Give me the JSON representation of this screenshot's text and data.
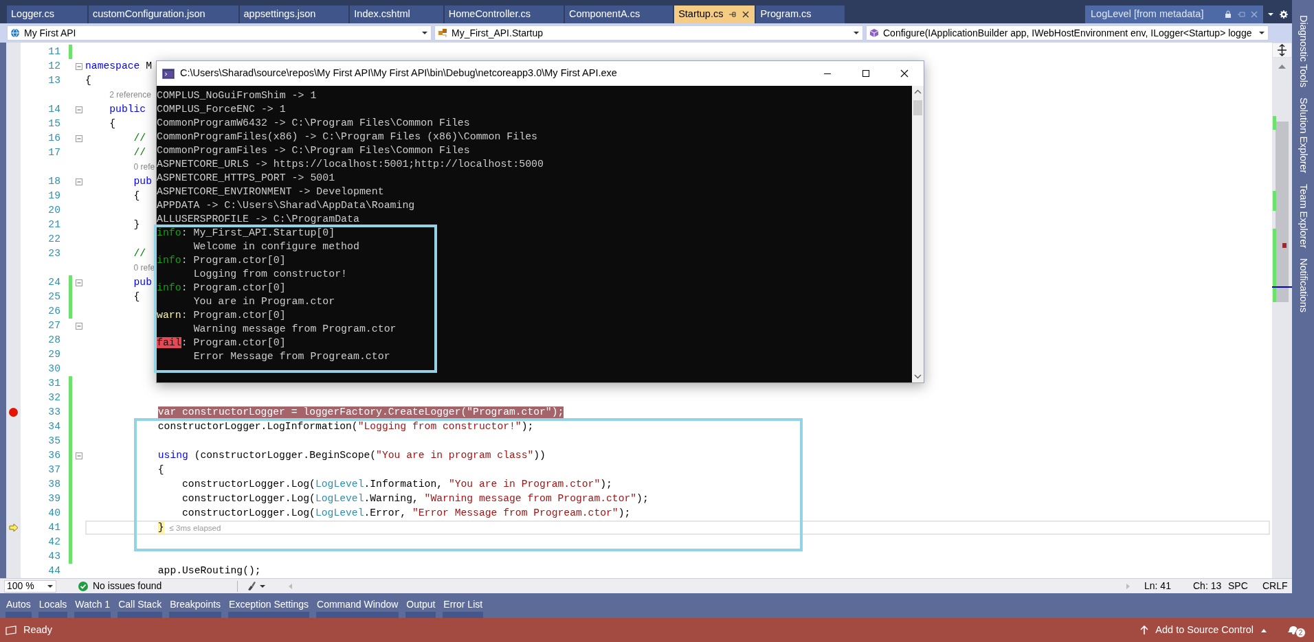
{
  "document_tabs": [
    {
      "label": "Logger.cs",
      "selected": false
    },
    {
      "label": "customConfiguration.json",
      "selected": false
    },
    {
      "label": "appsettings.json",
      "selected": false
    },
    {
      "label": "Index.cshtml",
      "selected": false
    },
    {
      "label": "HomeController.cs",
      "selected": false
    },
    {
      "label": "ComponentA.cs",
      "selected": false
    },
    {
      "label": "Startup.cs",
      "selected": true
    },
    {
      "label": "Program.cs",
      "selected": false
    }
  ],
  "preview_tab": {
    "label": "LogLevel [from metadata]"
  },
  "navigation_bar": {
    "project": "My First API",
    "type": "My_First_API.Startup",
    "member": "Configure(IApplicationBuilder app, IWebHostEnvironment env, ILogger<Startup> logge"
  },
  "editor": {
    "lines": [
      {
        "kind": "code",
        "number": "11",
        "changed": true,
        "foldable": false,
        "breakpoint": false,
        "current": false
      },
      {
        "kind": "code",
        "number": "12",
        "changed": false,
        "foldable": true,
        "breakpoint": false,
        "current": false,
        "tokens": [
          {
            "text": "namespace",
            "kind": "keyword"
          },
          {
            "text": " M",
            "kind": "plain"
          }
        ]
      },
      {
        "kind": "code",
        "number": "13",
        "changed": false,
        "foldable": false,
        "breakpoint": false,
        "current": false,
        "tokens": [
          {
            "text": "{",
            "kind": "plain"
          }
        ]
      },
      {
        "kind": "codelens",
        "text": "2 reference"
      },
      {
        "kind": "code",
        "number": "14",
        "changed": false,
        "foldable": true,
        "breakpoint": false,
        "current": false,
        "tokens": [
          {
            "text": "    public",
            "kind": "keyword"
          }
        ]
      },
      {
        "kind": "code",
        "number": "15",
        "changed": false,
        "foldable": false,
        "breakpoint": false,
        "current": false,
        "tokens": [
          {
            "text": "    {",
            "kind": "plain"
          }
        ]
      },
      {
        "kind": "code",
        "number": "16",
        "changed": false,
        "foldable": true,
        "breakpoint": false,
        "current": false,
        "tokens": [
          {
            "text": "        //",
            "kind": "comment"
          }
        ]
      },
      {
        "kind": "code",
        "number": "17",
        "changed": false,
        "foldable": false,
        "breakpoint": false,
        "current": false,
        "tokens": [
          {
            "text": "        //",
            "kind": "comment"
          }
        ]
      },
      {
        "kind": "codelens",
        "text": "0 refe"
      },
      {
        "kind": "code",
        "number": "18",
        "changed": false,
        "foldable": true,
        "breakpoint": false,
        "current": false,
        "tokens": [
          {
            "text": "        pub",
            "kind": "keyword"
          }
        ]
      },
      {
        "kind": "code",
        "number": "19",
        "changed": false,
        "foldable": false,
        "breakpoint": false,
        "current": false,
        "tokens": [
          {
            "text": "        {",
            "kind": "plain"
          }
        ]
      },
      {
        "kind": "code",
        "number": "20",
        "changed": false,
        "foldable": false,
        "breakpoint": false,
        "current": false
      },
      {
        "kind": "code",
        "number": "21",
        "changed": false,
        "foldable": false,
        "breakpoint": false,
        "current": false,
        "tokens": [
          {
            "text": "        }",
            "kind": "plain"
          }
        ]
      },
      {
        "kind": "code",
        "number": "22",
        "changed": false,
        "foldable": false,
        "breakpoint": false,
        "current": false
      },
      {
        "kind": "code",
        "number": "23",
        "changed": false,
        "foldable": false,
        "breakpoint": false,
        "current": false,
        "tokens": [
          {
            "text": "        //",
            "kind": "comment"
          }
        ]
      },
      {
        "kind": "codelens",
        "text": "0 refe"
      },
      {
        "kind": "code",
        "number": "24",
        "changed": true,
        "foldable": true,
        "breakpoint": false,
        "current": false,
        "tokens": [
          {
            "text": "        pub",
            "kind": "keyword"
          }
        ]
      },
      {
        "kind": "code",
        "number": "25",
        "changed": true,
        "foldable": false,
        "breakpoint": false,
        "current": false,
        "tokens": [
          {
            "text": "        {",
            "kind": "plain"
          }
        ]
      },
      {
        "kind": "code",
        "number": "26",
        "changed": true,
        "foldable": false,
        "breakpoint": false,
        "current": false
      },
      {
        "kind": "code",
        "number": "27",
        "changed": false,
        "foldable": true,
        "breakpoint": false,
        "current": false
      },
      {
        "kind": "code",
        "number": "28",
        "changed": false,
        "foldable": false,
        "breakpoint": false,
        "current": false
      },
      {
        "kind": "code",
        "number": "29",
        "changed": false,
        "foldable": false,
        "breakpoint": false,
        "current": false
      },
      {
        "kind": "code",
        "number": "30",
        "changed": false,
        "foldable": false,
        "breakpoint": false,
        "current": false
      },
      {
        "kind": "code",
        "number": "31",
        "changed": true,
        "foldable": false,
        "breakpoint": false,
        "current": false
      },
      {
        "kind": "code",
        "number": "32",
        "changed": true,
        "foldable": false,
        "breakpoint": false,
        "current": false
      },
      {
        "kind": "code",
        "number": "33",
        "changed": true,
        "foldable": false,
        "breakpoint": true,
        "current": false,
        "tokens": [
          {
            "text": "            var constructorLogger = loggerFactory.CreateLogger(\"Program.ctor\");",
            "kind": "plain"
          }
        ]
      },
      {
        "kind": "code",
        "number": "34",
        "changed": true,
        "foldable": false,
        "breakpoint": false,
        "current": false,
        "tokens": [
          {
            "text": "            constructorLogger.LogInformation(",
            "kind": "plain"
          },
          {
            "text": "\"Logging from constructor!\"",
            "kind": "string"
          },
          {
            "text": ");",
            "kind": "plain"
          }
        ]
      },
      {
        "kind": "code",
        "number": "35",
        "changed": true,
        "foldable": false,
        "breakpoint": false,
        "current": false
      },
      {
        "kind": "code",
        "number": "36",
        "changed": true,
        "foldable": true,
        "breakpoint": false,
        "current": false,
        "tokens": [
          {
            "text": "            using",
            "kind": "keyword"
          },
          {
            "text": " (constructorLogger.BeginScope(",
            "kind": "plain"
          },
          {
            "text": "\"You are in program class\"",
            "kind": "string"
          },
          {
            "text": "))",
            "kind": "plain"
          }
        ]
      },
      {
        "kind": "code",
        "number": "37",
        "changed": true,
        "foldable": false,
        "breakpoint": false,
        "current": false,
        "tokens": [
          {
            "text": "            {",
            "kind": "plain"
          }
        ]
      },
      {
        "kind": "code",
        "number": "38",
        "changed": true,
        "foldable": false,
        "breakpoint": false,
        "current": false,
        "tokens": [
          {
            "text": "                constructorLogger.Log(",
            "kind": "plain"
          },
          {
            "text": "LogLevel",
            "kind": "type"
          },
          {
            "text": ".Information, ",
            "kind": "plain"
          },
          {
            "text": "\"You are in Program.ctor\"",
            "kind": "string"
          },
          {
            "text": ");",
            "kind": "plain"
          }
        ]
      },
      {
        "kind": "code",
        "number": "39",
        "changed": true,
        "foldable": false,
        "breakpoint": false,
        "current": false,
        "tokens": [
          {
            "text": "                constructorLogger.Log(",
            "kind": "plain"
          },
          {
            "text": "LogLevel",
            "kind": "type"
          },
          {
            "text": ".Warning, ",
            "kind": "plain"
          },
          {
            "text": "\"Warning message from Program.ctor\"",
            "kind": "string"
          },
          {
            "text": ");",
            "kind": "plain"
          }
        ]
      },
      {
        "kind": "code",
        "number": "40",
        "changed": true,
        "foldable": false,
        "breakpoint": false,
        "current": false,
        "tokens": [
          {
            "text": "                constructorLogger.Log(",
            "kind": "plain"
          },
          {
            "text": "LogLevel",
            "kind": "type"
          },
          {
            "text": ".Error, ",
            "kind": "plain"
          },
          {
            "text": "\"Error Message from Progream.ctor\"",
            "kind": "string"
          },
          {
            "text": ");",
            "kind": "plain"
          }
        ]
      },
      {
        "kind": "code",
        "number": "41",
        "changed": true,
        "foldable": false,
        "breakpoint": false,
        "current": true,
        "hint": "≤ 3ms elapsed",
        "tokens": [
          {
            "text": "            }",
            "kind": "plain"
          }
        ]
      },
      {
        "kind": "code",
        "number": "42",
        "changed": true,
        "foldable": false,
        "breakpoint": false,
        "current": false
      },
      {
        "kind": "code",
        "number": "43",
        "changed": true,
        "foldable": false,
        "breakpoint": false,
        "current": false
      },
      {
        "kind": "code",
        "number": "44",
        "changed": false,
        "foldable": false,
        "breakpoint": false,
        "current": false,
        "tokens": [
          {
            "text": "            app.UseRouting();",
            "kind": "plain"
          }
        ]
      }
    ]
  },
  "console_window": {
    "title": "C:\\Users\\Sharad\\source\\repos\\My First API\\My First API\\bin\\Debug\\netcoreapp3.0\\My First API.exe",
    "lines": [
      {
        "kind": "plain",
        "text": "COMPLUS_NoGuiFromShim -> 1"
      },
      {
        "kind": "plain",
        "text": "COMPLUS_ForceENC -> 1"
      },
      {
        "kind": "plain",
        "text": "CommonProgramW6432 -> C:\\Program Files\\Common Files"
      },
      {
        "kind": "plain",
        "text": "CommonProgramFiles(x86) -> C:\\Program Files (x86)\\Common Files"
      },
      {
        "kind": "plain",
        "text": "CommonProgramFiles -> C:\\Program Files\\Common Files"
      },
      {
        "kind": "plain",
        "text": "ASPNETCORE_URLS -> https://localhost:5001;http://localhost:5000"
      },
      {
        "kind": "plain",
        "text": "ASPNETCORE_HTTPS_PORT -> 5001"
      },
      {
        "kind": "plain",
        "text": "ASPNETCORE_ENVIRONMENT -> Development"
      },
      {
        "kind": "plain",
        "text": "APPDATA -> C:\\Users\\Sharad\\AppData\\Roaming"
      },
      {
        "kind": "plain",
        "text": "ALLUSERSPROFILE -> C:\\ProgramData"
      },
      {
        "kind": "info",
        "tag": "info",
        "text": ": My_First_API.Startup[0]"
      },
      {
        "kind": "plain",
        "text": "      Welcome in configure method"
      },
      {
        "kind": "info",
        "tag": "info",
        "text": ": Program.ctor[0]"
      },
      {
        "kind": "plain",
        "text": "      Logging from constructor!"
      },
      {
        "kind": "info",
        "tag": "info",
        "text": ": Program.ctor[0]"
      },
      {
        "kind": "plain",
        "text": "      You are in Program.ctor"
      },
      {
        "kind": "warn",
        "tag": "warn",
        "text": ": Program.ctor[0]"
      },
      {
        "kind": "plain",
        "text": "      Warning message from Program.ctor"
      },
      {
        "kind": "fail",
        "tag": "fail",
        "text": ": Program.ctor[0]"
      },
      {
        "kind": "plain",
        "text": "      Error Message from Progream.ctor"
      }
    ]
  },
  "editor_status": {
    "zoom": "100 %",
    "issues": "No issues found",
    "line": "Ln: 41",
    "column": "Ch: 13",
    "whitespace": "SPC",
    "line_ending": "CRLF"
  },
  "tool_tabs": [
    "Autos",
    "Locals",
    "Watch 1",
    "Call Stack",
    "Breakpoints",
    "Exception Settings",
    "Command Window",
    "Output",
    "Error List"
  ],
  "side_tabs": [
    "Diagnostic Tools",
    "Solution Explorer",
    "Team Explorer",
    "Notifications"
  ],
  "status_bar": {
    "text": "Ready",
    "source_control": "Add to Source Control",
    "notifications": "2"
  }
}
